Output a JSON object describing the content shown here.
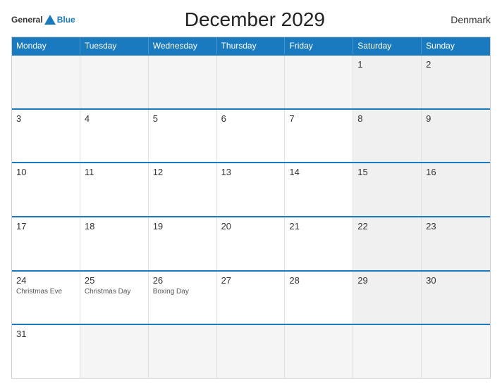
{
  "header": {
    "logo_general": "General",
    "logo_blue": "Blue",
    "title": "December 2029",
    "country": "Denmark"
  },
  "weekdays": [
    "Monday",
    "Tuesday",
    "Wednesday",
    "Thursday",
    "Friday",
    "Saturday",
    "Sunday"
  ],
  "rows": [
    [
      {
        "day": "",
        "empty": true
      },
      {
        "day": "",
        "empty": true
      },
      {
        "day": "",
        "empty": true
      },
      {
        "day": "",
        "empty": true
      },
      {
        "day": "",
        "empty": true
      },
      {
        "day": "1",
        "weekend": true
      },
      {
        "day": "2",
        "weekend": true
      }
    ],
    [
      {
        "day": "3"
      },
      {
        "day": "4"
      },
      {
        "day": "5"
      },
      {
        "day": "6"
      },
      {
        "day": "7"
      },
      {
        "day": "8",
        "weekend": true
      },
      {
        "day": "9",
        "weekend": true
      }
    ],
    [
      {
        "day": "10"
      },
      {
        "day": "11"
      },
      {
        "day": "12"
      },
      {
        "day": "13"
      },
      {
        "day": "14"
      },
      {
        "day": "15",
        "weekend": true
      },
      {
        "day": "16",
        "weekend": true
      }
    ],
    [
      {
        "day": "17"
      },
      {
        "day": "18"
      },
      {
        "day": "19"
      },
      {
        "day": "20"
      },
      {
        "day": "21"
      },
      {
        "day": "22",
        "weekend": true
      },
      {
        "day": "23",
        "weekend": true
      }
    ],
    [
      {
        "day": "24",
        "event": "Christmas Eve"
      },
      {
        "day": "25",
        "event": "Christmas Day"
      },
      {
        "day": "26",
        "event": "Boxing Day"
      },
      {
        "day": "27"
      },
      {
        "day": "28"
      },
      {
        "day": "29",
        "weekend": true
      },
      {
        "day": "30",
        "weekend": true
      }
    ],
    [
      {
        "day": "31"
      },
      {
        "day": "",
        "empty": true
      },
      {
        "day": "",
        "empty": true
      },
      {
        "day": "",
        "empty": true
      },
      {
        "day": "",
        "empty": true
      },
      {
        "day": "",
        "empty": true
      },
      {
        "day": "",
        "empty": true
      }
    ]
  ]
}
